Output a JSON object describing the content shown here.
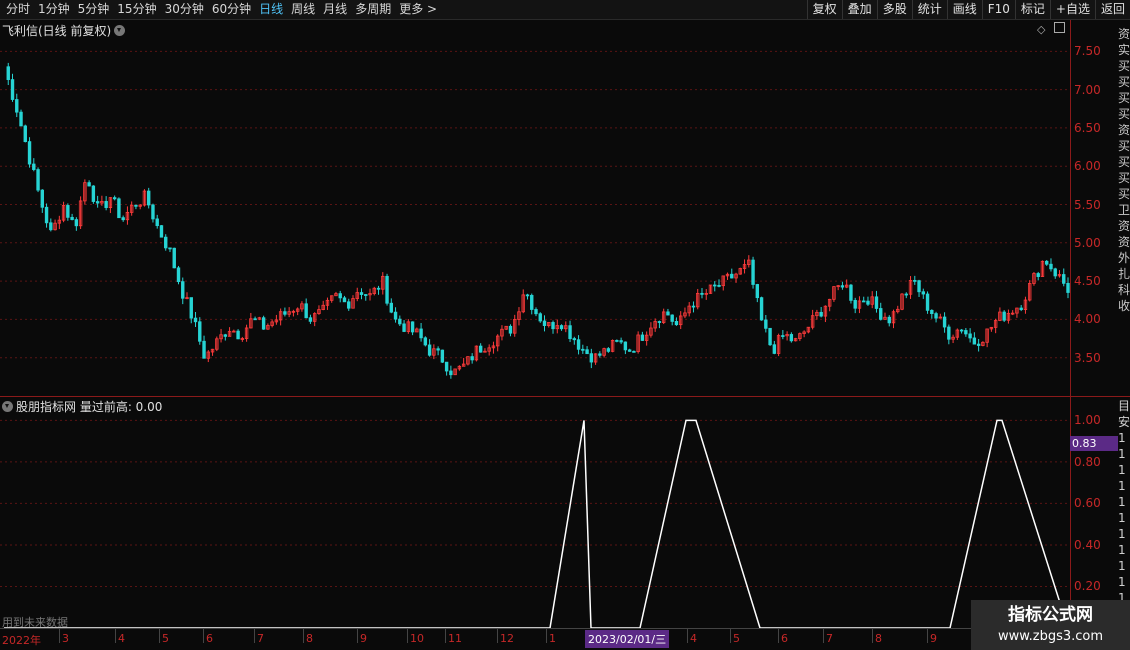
{
  "toolbar": {
    "periods": [
      "分时",
      "1分钟",
      "5分钟",
      "15分钟",
      "30分钟",
      "60分钟",
      "日线",
      "周线",
      "月线",
      "多周期",
      "更多 >"
    ],
    "active_period": "日线",
    "buttons": [
      "复权",
      "叠加",
      "多股",
      "统计",
      "画线",
      "F10",
      "标记",
      "+自选",
      "返回"
    ]
  },
  "main_panel": {
    "title": "飞利信(日线 前复权)"
  },
  "indicator_panel": {
    "title": "股朋指标网 量过前高: 0.00"
  },
  "price_axis": [
    "7.50",
    "7.00",
    "6.50",
    "6.00",
    "5.50",
    "5.00",
    "4.50",
    "4.00",
    "3.50"
  ],
  "ind_axis": [
    "1.00",
    "0.80",
    "0.60",
    "0.40",
    "0.20"
  ],
  "value_tag": "0.83",
  "date_tag": "2023/02/01/三",
  "x_axis": [
    "2022年",
    "3",
    "4",
    "5",
    "6",
    "7",
    "8",
    "9",
    "10",
    "11",
    "12",
    "1",
    "4",
    "5",
    "6",
    "7",
    "8",
    "9"
  ],
  "note": "用到未来数据",
  "logo": {
    "line1": "指标公式网",
    "line2": "www.zbgs3.com"
  },
  "side_text_top": "资\n实\n买\n买\n买\n买\n资\n买\n买\n买\n买\n卫\n资\n资\n外\n扎\n科\n收",
  "side_text_bottom": "目\n安\n1\n1\n1\n1\n1\n1\n1\n1\n1\n1\n1\n1",
  "colors": {
    "up": "#ff3b3b",
    "down": "#27d4d4",
    "axis": "#c62828",
    "accent": "#5b2a86"
  },
  "chart_data": [
    {
      "type": "candlestick",
      "ylim": [
        3.0,
        7.7
      ],
      "ticks": [
        7.5,
        7.0,
        6.5,
        6.0,
        5.5,
        5.0,
        4.5,
        4.0,
        3.5
      ],
      "close_path": [
        7.3,
        6.8,
        6.2,
        5.6,
        5.1,
        5.5,
        5.2,
        5.9,
        5.4,
        5.6,
        5.3,
        5.5,
        5.6,
        5.2,
        4.9,
        4.4,
        4.0,
        3.5,
        3.7,
        3.9,
        3.8,
        4.0,
        3.9,
        4.0,
        4.1,
        4.2,
        4.0,
        4.1,
        4.3,
        4.2,
        4.4,
        4.3,
        4.5,
        4.0,
        3.9,
        3.8,
        3.6,
        3.5,
        3.3,
        3.4,
        3.6,
        3.7,
        3.8,
        3.9,
        4.4,
        4.1,
        3.9,
        4.0,
        3.8,
        3.6,
        3.5,
        3.6,
        3.7,
        3.6,
        3.8,
        4.0,
        4.1,
        3.9,
        4.2,
        4.3,
        4.4,
        4.5,
        4.6,
        4.7,
        4.0,
        3.6,
        3.8,
        3.7,
        3.9,
        4.1,
        4.3,
        4.5,
        4.2,
        4.3,
        4.1,
        4.0,
        4.3,
        4.5,
        4.2,
        4.0,
        3.8,
        3.9,
        3.7,
        3.8,
        4.0,
        4.1,
        4.2,
        4.5,
        4.8,
        4.6,
        4.4
      ]
    },
    {
      "type": "line",
      "ylim": [
        0,
        1.05
      ],
      "ticks": [
        1.0,
        0.8,
        0.6,
        0.4,
        0.2
      ],
      "series": [
        {
          "values": [
            0,
            0,
            0,
            0,
            0,
            1,
            0,
            0,
            1,
            1,
            0,
            0,
            0,
            0,
            1,
            1,
            0
          ]
        }
      ]
    }
  ]
}
